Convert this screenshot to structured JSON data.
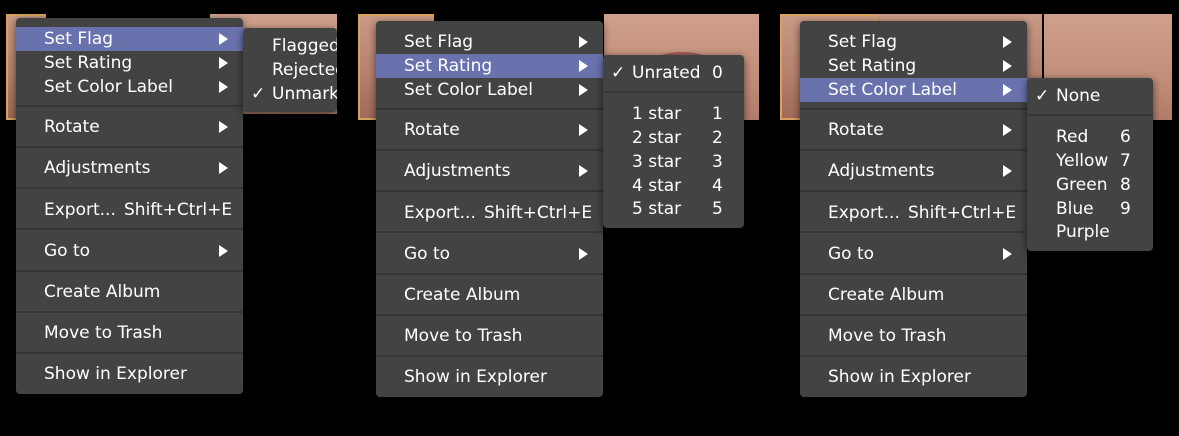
{
  "menu": {
    "set_flag": "Set Flag",
    "set_rating": "Set Rating",
    "set_color_label": "Set Color Label",
    "rotate": "Rotate",
    "adjustments": "Adjustments",
    "export": "Export...",
    "export_shortcut": "Shift+Ctrl+E",
    "go_to": "Go to",
    "create_album": "Create Album",
    "move_to_trash": "Move to Trash",
    "show_in_explorer": "Show in Explorer"
  },
  "flag_submenu": {
    "checkmark": "✓",
    "items": [
      "Flagged",
      "Rejected",
      "Unmarked"
    ]
  },
  "rating_submenu": {
    "checkmark": "✓",
    "items": [
      {
        "label": "Unrated",
        "key": "0"
      },
      {
        "label": "1 star",
        "key": "1"
      },
      {
        "label": "2 star",
        "key": "2"
      },
      {
        "label": "3 star",
        "key": "3"
      },
      {
        "label": "4 star",
        "key": "4"
      },
      {
        "label": "5 star",
        "key": "5"
      }
    ]
  },
  "color_submenu": {
    "checkmark": "✓",
    "items": [
      {
        "label": "None",
        "key": ""
      },
      {
        "label": "Red",
        "key": "6"
      },
      {
        "label": "Yellow",
        "key": "7"
      },
      {
        "label": "Green",
        "key": "8"
      },
      {
        "label": "Blue",
        "key": "9"
      },
      {
        "label": "Purple",
        "key": ""
      }
    ]
  },
  "colors": {
    "menu_bg": "#434343",
    "highlight": "#6a72ad",
    "separator": "#353535",
    "selection_border": "#d9a25c"
  }
}
